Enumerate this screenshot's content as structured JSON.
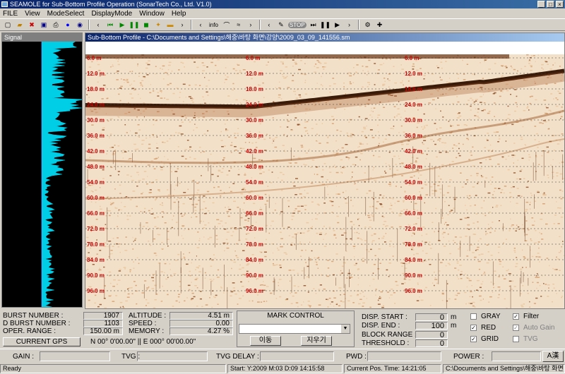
{
  "window": {
    "title": "SEAMOLE for Sub-Bottom Profile Operation (SonarTech Co., Ltd.  V1.0)",
    "controls": [
      "_",
      "□",
      "×"
    ]
  },
  "menu": [
    "FILE",
    "View",
    "ModeSelect",
    "DisplayMode",
    "Window",
    "Help"
  ],
  "toolbar": {
    "info_label": "info",
    "stop_label": "STOP"
  },
  "signal": {
    "title": "Signal"
  },
  "profile": {
    "title": "Sub-Bottom Profile - C:\\Documents and Settings\\해중\\바탕 화면\\강양\\2009_03_09_141556.sm",
    "depth_labels": [
      "6.0 m",
      "12.0 m",
      "18.0 m",
      "24.0 m",
      "30.0 m",
      "36.0 m",
      "42.0 m",
      "48.0 m",
      "54.0 m",
      "60.0 m",
      "66.0 m",
      "72.0 m",
      "78.0 m",
      "84.0 m",
      "90.0 m",
      "96.0 m"
    ]
  },
  "info": {
    "burst_number_label": "BURST NUMBER :",
    "burst_number": "1907",
    "d_burst_number_label": "D BURST NUMBER :",
    "d_burst_number": "1103",
    "oper_range_label": "OPER. RANGE :",
    "oper_range": "150.00 m",
    "altitude_label": "ALTITUDE :",
    "altitude": "4.51 m",
    "speed_label": "SPEED :",
    "speed": "0.00",
    "memory_label": "MEMORY :",
    "memory": "4.27 %",
    "gps_button": "CURRENT GPS",
    "gps_value": "N 00°  0'00.00\" || E 000°  00'00.00\""
  },
  "mark_control": {
    "title": "MARK CONTROL",
    "selected": "",
    "move_button": "이동",
    "clear_button": "지우기"
  },
  "display": {
    "disp_start_label": "DISP. START :",
    "disp_start": "0",
    "disp_start_unit": "m",
    "disp_end_label": "DISP. END :",
    "disp_end": "100",
    "disp_end_unit": "m",
    "block_range_label": "BLOCK RANGE :",
    "block_range": "0",
    "threshold_label": "THRESHOLD :",
    "threshold": "0"
  },
  "options": {
    "gray": "GRAY",
    "gray_checked": false,
    "red": "RED",
    "red_checked": true,
    "grid": "GRID",
    "grid_checked": true,
    "filter": "Filter",
    "filter_checked": true,
    "auto_gain": "Auto Gain",
    "auto_gain_checked": true,
    "tvg": "TVG",
    "tvg_checked": false
  },
  "controls": {
    "gain": "GAIN :",
    "tvg": "TVG :",
    "tvg_delay": "TVG DELAY :",
    "pwd": "PWD :",
    "power": "POWER :",
    "ime": "A漢"
  },
  "status": {
    "ready": "Ready",
    "start": "Start: Y:2009 M:03 D:09 14:15:58",
    "current": "Current Pos.  Time: 14:21:05",
    "path": "C:\\Documents and Settings\\해중\\바탕 화면"
  },
  "colors": {
    "depth_label": "#cc0000",
    "signal_trace": "#00e5ff",
    "sonar_background": "#f2e0c8",
    "seabed_strong": "#3a1a08",
    "title_gradient": "#0a246a"
  }
}
